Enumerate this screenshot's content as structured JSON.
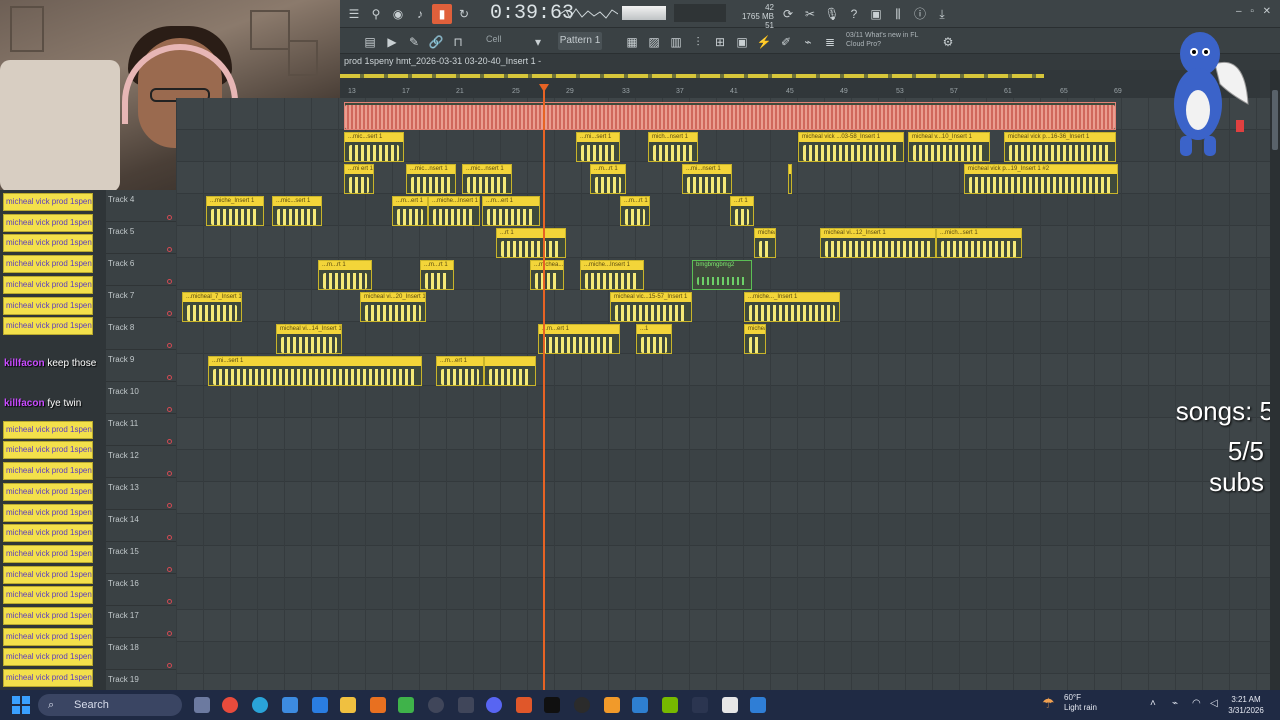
{
  "toolbar": {
    "time": "0:39:63",
    "cpu_memory": "42\n1765 MB\n51",
    "snap": "Cell",
    "pattern": "Pattern 1",
    "news_line1": "03/11 What's new in FL",
    "news_line2": "Cloud Pro?"
  },
  "playlist": {
    "title": "prod 1speny hmt_2026-03-31 03-20-40_Insert 1 -",
    "bar_numbers": [
      "13",
      "17",
      "21",
      "25",
      "29",
      "33",
      "37",
      "41",
      "45",
      "49",
      "53",
      "57",
      "61",
      "65",
      "69"
    ]
  },
  "tracks": [
    {
      "label": "Track 4"
    },
    {
      "label": "Track 5"
    },
    {
      "label": "Track 6"
    },
    {
      "label": "Track 7"
    },
    {
      "label": "Track 8"
    },
    {
      "label": "Track 9"
    },
    {
      "label": "Track 10"
    },
    {
      "label": "Track 11"
    },
    {
      "label": "Track 12"
    },
    {
      "label": "Track 13"
    },
    {
      "label": "Track 14"
    },
    {
      "label": "Track 15"
    },
    {
      "label": "Track 16"
    },
    {
      "label": "Track 17"
    },
    {
      "label": "Track 18"
    },
    {
      "label": "Track 19"
    }
  ],
  "sample_label": "micheal vick prod 1speny...",
  "clips": [
    {
      "label": "...mic...sert 1"
    },
    {
      "label": "...mi...sert 1"
    },
    {
      "label": "mich...nsert 1"
    },
    {
      "label": "micheal vick ...03-58_Insert 1"
    },
    {
      "label": "micheal v...10_Insert 1"
    },
    {
      "label": "micheal vick p...16-36_Insert 1"
    },
    {
      "label": "...mi ert 1"
    },
    {
      "label": "...mic...nsert 1"
    },
    {
      "label": "...mic...nsert 1"
    },
    {
      "label": "...m...rt 1"
    },
    {
      "label": "...mi...nsert 1"
    },
    {
      "label": "micheal 3"
    },
    {
      "label": "micheal vick p...19_Insert 1 #2"
    },
    {
      "label": "...miche_Insert 1"
    },
    {
      "label": "...mic...sert 1"
    },
    {
      "label": "...m...ert 1"
    },
    {
      "label": "...miche...Insert 1"
    },
    {
      "label": "...m...ert 1"
    },
    {
      "label": "...m...rt 1"
    },
    {
      "label": "...rt 1"
    },
    {
      "label": "...micheal_2_Insert 1"
    },
    {
      "label": "...rt 1"
    },
    {
      "label": "micheal vick pro...03-16-12_Insert 1"
    },
    {
      "label": "micheal vi...12_Insert 1"
    },
    {
      "label": "...mich...sert 1"
    },
    {
      "label": "...m...rt 1"
    },
    {
      "label": "...m...rt 1"
    },
    {
      "label": "...michea..._Insert 1"
    },
    {
      "label": "...miche...Insert 1"
    },
    {
      "label": "bmgbmgbmg2"
    },
    {
      "label": "...micheal_7_Insert 1"
    },
    {
      "label": "micheal vi...20_Insert 1"
    },
    {
      "label": "micheal vic...15-57_Insert 1"
    },
    {
      "label": "...miche..._Insert 1"
    },
    {
      "label": "micheal vi...14_Insert 1"
    },
    {
      "label": "...m...ert 1"
    },
    {
      "label": "...1"
    },
    {
      "label": "micheal vick prod 1speny hmt_2026-03-31 03-09-18_Insert 1"
    },
    {
      "label": "...mi...sert 1"
    },
    {
      "label": "...m...ert 1"
    }
  ],
  "chat": [
    {
      "user": "",
      "text": ""
    },
    {
      "user": "killfacon",
      "text": "keep those"
    },
    {
      "user": "",
      "text": ""
    },
    {
      "user": "killfacon",
      "text": "fye twin"
    }
  ],
  "overlay": {
    "songs": "songs: 5",
    "subs": "5/5 subs"
  },
  "taskbar": {
    "search": "Search",
    "weather_temp": "60°F",
    "weather_desc": "Light rain",
    "time": "3:21 AM",
    "date": "3/31/2026"
  }
}
